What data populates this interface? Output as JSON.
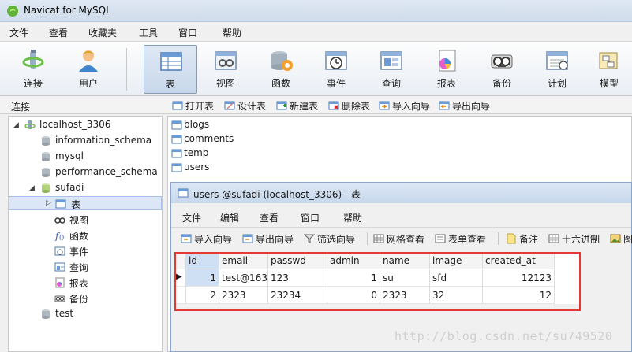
{
  "window": {
    "title": "Navicat for MySQL"
  },
  "menu": [
    "文件",
    "查看",
    "收藏夹",
    "工具",
    "窗口",
    "帮助"
  ],
  "toolbar": [
    {
      "label": "连接",
      "icon": "connection-icon"
    },
    {
      "label": "用户",
      "icon": "user-icon"
    },
    {
      "label": "表",
      "icon": "table-icon",
      "active": true
    },
    {
      "label": "视图",
      "icon": "view-icon"
    },
    {
      "label": "函数",
      "icon": "function-icon"
    },
    {
      "label": "事件",
      "icon": "event-icon"
    },
    {
      "label": "查询",
      "icon": "query-icon"
    },
    {
      "label": "报表",
      "icon": "report-icon"
    },
    {
      "label": "备份",
      "icon": "backup-icon"
    },
    {
      "label": "计划",
      "icon": "schedule-icon"
    },
    {
      "label": "模型",
      "icon": "model-icon"
    }
  ],
  "sidebar": {
    "title": "连接",
    "items": [
      {
        "label": "localhost_3306",
        "icon": "connection-icon"
      },
      {
        "label": "information_schema",
        "icon": "database-icon"
      },
      {
        "label": "mysql",
        "icon": "database-icon"
      },
      {
        "label": "performance_schema",
        "icon": "database-icon"
      },
      {
        "label": "sufadi",
        "icon": "database-icon"
      },
      {
        "label": "表",
        "icon": "table-icon"
      },
      {
        "label": "视图",
        "icon": "view-icon"
      },
      {
        "label": "函数",
        "icon": "function-icon"
      },
      {
        "label": "事件",
        "icon": "event-icon"
      },
      {
        "label": "查询",
        "icon": "query-icon"
      },
      {
        "label": "报表",
        "icon": "report-icon"
      },
      {
        "label": "备份",
        "icon": "backup-icon"
      },
      {
        "label": "test",
        "icon": "database-icon"
      }
    ]
  },
  "object_actions": [
    "打开表",
    "设计表",
    "新建表",
    "删除表",
    "导入向导",
    "导出向导"
  ],
  "tables": [
    "blogs",
    "comments",
    "temp",
    "users"
  ],
  "subwindow": {
    "title": "users @sufadi (localhost_3306) - 表",
    "menu": [
      "文件",
      "编辑",
      "查看",
      "窗口",
      "帮助"
    ],
    "tools": [
      "导入向导",
      "导出向导",
      "筛选向导",
      "网格查看",
      "表单查看",
      "备注",
      "十六进制",
      "图"
    ]
  },
  "grid": {
    "columns": [
      "id",
      "email",
      "passwd",
      "admin",
      "name",
      "image",
      "created_at"
    ],
    "rows": [
      [
        "1",
        "test@163",
        "123",
        "1",
        "su",
        "sfd",
        "12123"
      ],
      [
        "2",
        "2323",
        "23234",
        "0",
        "2323",
        "32",
        "12"
      ]
    ]
  },
  "watermark": "http://blog.csdn.net/su749520",
  "colors": {
    "highlight": "#e53935",
    "active_tool": "#c8d7ea",
    "selection": "#dbe7f7"
  }
}
